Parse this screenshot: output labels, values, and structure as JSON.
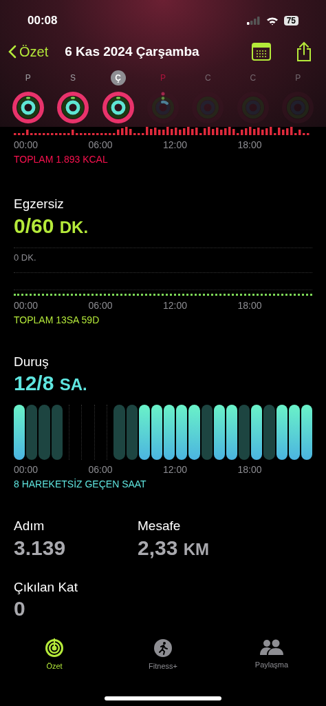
{
  "status_bar": {
    "time": "00:08",
    "battery": "75"
  },
  "nav": {
    "back": "Özet",
    "title": "6 Kas 2024 Çarşamba"
  },
  "week": [
    {
      "letter": "P",
      "selected": false,
      "today": false,
      "kind": "complete"
    },
    {
      "letter": "S",
      "selected": false,
      "today": false,
      "kind": "complete"
    },
    {
      "letter": "Ç",
      "selected": true,
      "today": false,
      "kind": "complete"
    },
    {
      "letter": "P",
      "selected": false,
      "today": true,
      "kind": "partial"
    },
    {
      "letter": "C",
      "selected": false,
      "today": false,
      "kind": "future"
    },
    {
      "letter": "C",
      "selected": false,
      "today": false,
      "kind": "future"
    },
    {
      "letter": "P",
      "selected": false,
      "today": false,
      "kind": "future"
    }
  ],
  "move": {
    "axis": [
      "00:00",
      "06:00",
      "12:00",
      "18:00"
    ],
    "total": "TOPLAM 1.893 KCAL"
  },
  "exercise": {
    "label": "Egzersiz",
    "value": "0/60",
    "unit": "DK.",
    "scale": "0 DK.",
    "axis": [
      "00:00",
      "06:00",
      "12:00",
      "18:00"
    ],
    "total": "TOPLAM 13SA 59D"
  },
  "stand": {
    "label": "Duruş",
    "value": "12/8",
    "unit": "SA.",
    "hours": [
      {
        "kind": "stood"
      },
      {
        "kind": "missed"
      },
      {
        "kind": "missed"
      },
      {
        "kind": "missed"
      },
      {
        "kind": "none"
      },
      {
        "kind": "none"
      },
      {
        "kind": "none"
      },
      {
        "kind": "none"
      },
      {
        "kind": "missed"
      },
      {
        "kind": "missed"
      },
      {
        "kind": "stood"
      },
      {
        "kind": "stood"
      },
      {
        "kind": "stood"
      },
      {
        "kind": "stood"
      },
      {
        "kind": "stood"
      },
      {
        "kind": "missed"
      },
      {
        "kind": "stood"
      },
      {
        "kind": "stood"
      },
      {
        "kind": "missed"
      },
      {
        "kind": "stood"
      },
      {
        "kind": "missed"
      },
      {
        "kind": "stood"
      },
      {
        "kind": "stood"
      },
      {
        "kind": "stood"
      }
    ],
    "axis": [
      "00:00",
      "06:00",
      "12:00",
      "18:00"
    ],
    "total": "8 HAREKETSİZ GEÇEN SAAT"
  },
  "stats": [
    {
      "label": "Adım",
      "value": "3.139"
    },
    {
      "label": "Mesafe",
      "value": "2,33",
      "unit": "KM"
    },
    {
      "label": "Çıkılan Kat",
      "value": "0"
    }
  ],
  "tabs": [
    {
      "label": "Özet",
      "selected": true,
      "kind": "summary"
    },
    {
      "label": "Fitness+",
      "selected": false,
      "kind": "fitness"
    },
    {
      "label": "Paylaşma",
      "selected": false,
      "kind": "sharing"
    }
  ]
}
